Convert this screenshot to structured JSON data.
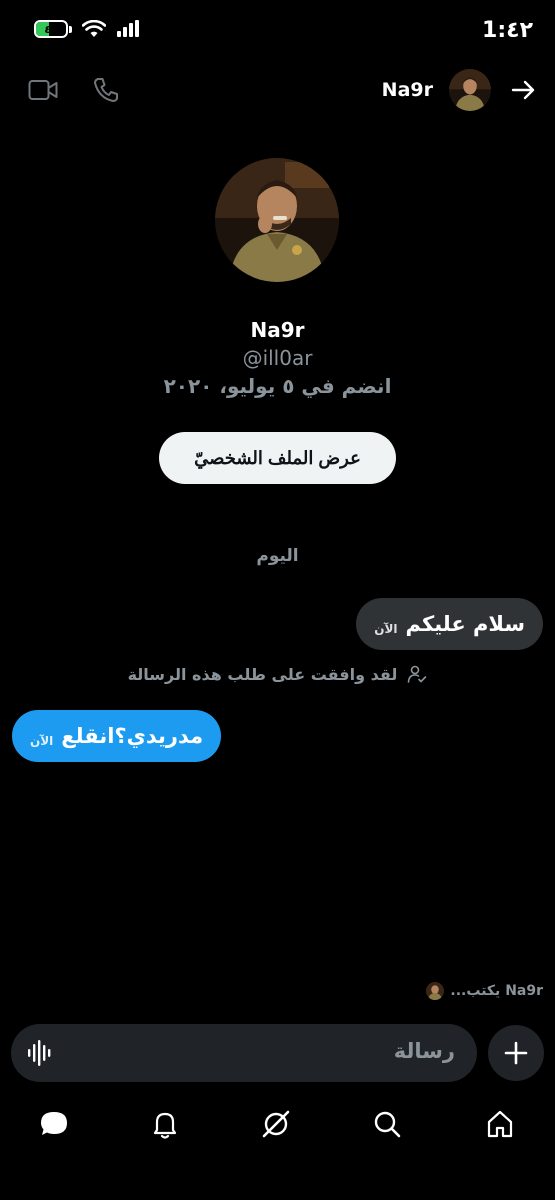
{
  "status_bar": {
    "time": "1:٤٢",
    "battery_percent": "٤٣",
    "battery_level": 0.43
  },
  "header": {
    "name": "Na9r"
  },
  "profile": {
    "name": "Na9r",
    "handle": "@ill0ar",
    "joined": "انضم في ٥ يوليو، ٢٠٢٠",
    "view_profile_label": "عرض الملف الشخصيّ"
  },
  "conversation": {
    "date_label": "اليوم",
    "messages": [
      {
        "text": "سلام عليكم",
        "time": "الآن",
        "direction": "incoming"
      },
      {
        "text": "مدريدي؟انقلع",
        "time": "الآن",
        "direction": "outgoing"
      }
    ],
    "accepted_notice": "لقد وافقت على طلب هذه الرسالة",
    "typing_indicator": "Na9r يكتب..."
  },
  "composer": {
    "placeholder": "رسالة"
  },
  "colors": {
    "accent": "#1d9bf0",
    "background": "#000000",
    "bubble_incoming": "#2f3336",
    "muted": "#8b949a"
  },
  "tabs": [
    "home-icon",
    "search-icon",
    "grok-icon",
    "notifications-icon",
    "messages-icon"
  ]
}
